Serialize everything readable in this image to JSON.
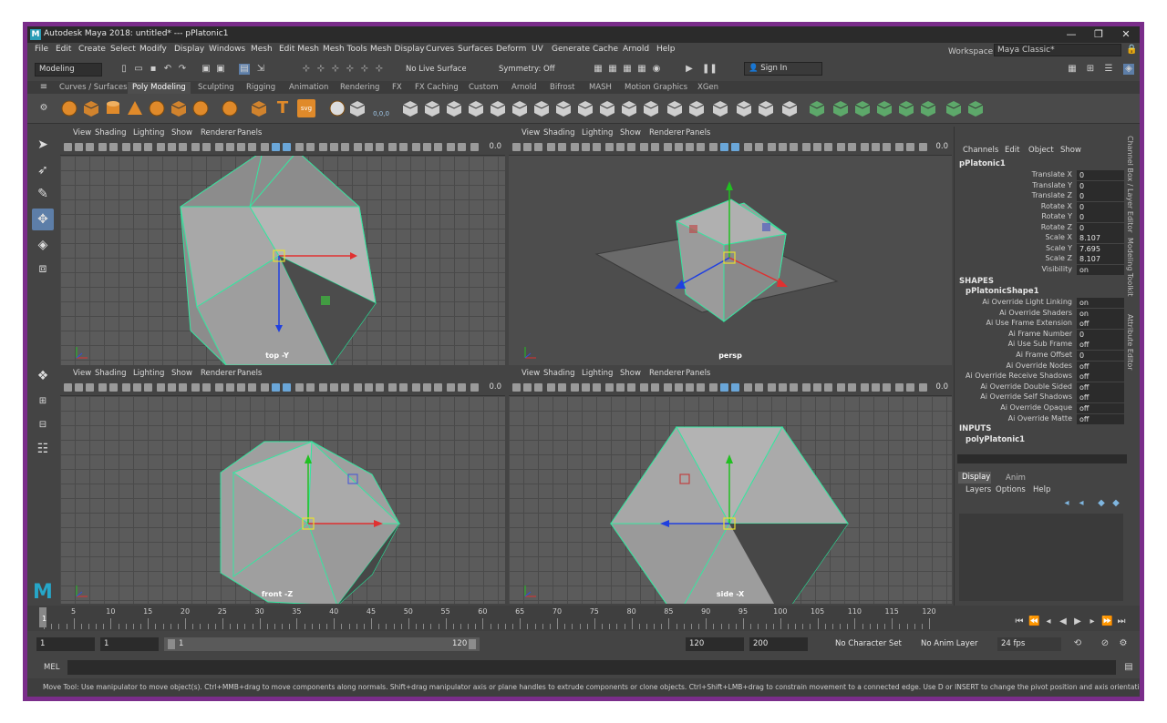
{
  "window": {
    "title": "Autodesk Maya 2018: untitled*   ---   pPlatonic1",
    "logo_letter": "M"
  },
  "menubar": [
    "File",
    "Edit",
    "Create",
    "Select",
    "Modify",
    "Display",
    "Windows",
    "Mesh",
    "Edit Mesh",
    "Mesh Tools",
    "Mesh Display",
    "Curves",
    "Surfaces",
    "Deform",
    "UV",
    "Generate",
    "Cache",
    "Arnold",
    "Help"
  ],
  "workspace": {
    "label": "Workspace :",
    "value": "Maya Classic*"
  },
  "status": {
    "mode": "Modeling",
    "live_surface": "No Live Surface",
    "symmetry": "Symmetry: Off",
    "sign_in": "Sign In"
  },
  "shelf_tabs": [
    "Curves / Surfaces",
    "Poly Modeling",
    "Sculpting",
    "Rigging",
    "Animation",
    "Rendering",
    "FX",
    "FX Caching",
    "Custom",
    "Arnold",
    "Bifrost",
    "MASH",
    "Motion Graphics",
    "XGen"
  ],
  "shelf_active": "Poly Modeling",
  "shelf_text": {
    "text_tool": "T",
    "svg_tool": "svg",
    "coord": "0,0,0"
  },
  "viewport_menu": [
    "View",
    "Shading",
    "Lighting",
    "Show",
    "Renderer",
    "Panels"
  ],
  "viewports": [
    {
      "label": "top -Y",
      "value": "0.0"
    },
    {
      "label": "persp",
      "value": "0.0"
    },
    {
      "label": "front -Z",
      "value": "0.0"
    },
    {
      "label": "side -X",
      "value": "0.0"
    }
  ],
  "channel_box": {
    "menu": [
      "Channels",
      "Edit",
      "Object",
      "Show"
    ],
    "object": "pPlatonic1",
    "transform": [
      {
        "k": "Translate X",
        "v": "0"
      },
      {
        "k": "Translate Y",
        "v": "0"
      },
      {
        "k": "Translate Z",
        "v": "0"
      },
      {
        "k": "Rotate X",
        "v": "0"
      },
      {
        "k": "Rotate Y",
        "v": "0"
      },
      {
        "k": "Rotate Z",
        "v": "0"
      },
      {
        "k": "Scale X",
        "v": "8.107"
      },
      {
        "k": "Scale Y",
        "v": "7.695"
      },
      {
        "k": "Scale Z",
        "v": "8.107"
      },
      {
        "k": "Visibility",
        "v": "on"
      }
    ],
    "shapes_header": "SHAPES",
    "shape_name": "pPlatonicShape1",
    "shape_attrs": [
      {
        "k": "Ai Override Light Linking",
        "v": "on"
      },
      {
        "k": "Ai Override Shaders",
        "v": "on"
      },
      {
        "k": "Ai Use Frame Extension",
        "v": "off"
      },
      {
        "k": "Ai Frame Number",
        "v": "0"
      },
      {
        "k": "Ai Use Sub Frame",
        "v": "off"
      },
      {
        "k": "Ai Frame Offset",
        "v": "0"
      },
      {
        "k": "Ai Override Nodes",
        "v": "off"
      },
      {
        "k": "Ai Override Receive Shadows",
        "v": "off"
      },
      {
        "k": "Ai Override Double Sided",
        "v": "off"
      },
      {
        "k": "Ai Override Self Shadows",
        "v": "off"
      },
      {
        "k": "Ai Override Opaque",
        "v": "off"
      },
      {
        "k": "Ai Override Matte",
        "v": "off"
      }
    ],
    "inputs_header": "INPUTS",
    "input_name": "polyPlatonic1"
  },
  "side_tabs": [
    "Channel Box / Layer Editor",
    "Modeling Toolkit",
    "Attribute Editor"
  ],
  "layer_editor": {
    "tabs": [
      "Display",
      "Anim"
    ],
    "menu": [
      "Layers",
      "Options",
      "Help"
    ]
  },
  "timeline": {
    "ticks": [
      "5",
      "10",
      "15",
      "20",
      "25",
      "30",
      "35",
      "40",
      "45",
      "50",
      "55",
      "60",
      "65",
      "70",
      "75",
      "80",
      "85",
      "90",
      "95",
      "100",
      "105",
      "110",
      "115",
      "120"
    ],
    "current": "1"
  },
  "range": {
    "start": "1",
    "start2": "1",
    "slider_start": "1",
    "slider_end": "120",
    "end": "120",
    "end2": "200",
    "character_set": "No Character Set",
    "anim_layer": "No Anim Layer",
    "fps": "24 fps"
  },
  "command": {
    "lang": "MEL"
  },
  "help_text": "Move Tool: Use manipulator to move object(s). Ctrl+MMB+drag to move components along normals. Shift+drag manipulator axis or plane handles to extrude components or clone objects. Ctrl+Shift+LMB+drag to constrain movement to a connected edge. Use D or INSERT to change the pivot position and axis orientation."
}
